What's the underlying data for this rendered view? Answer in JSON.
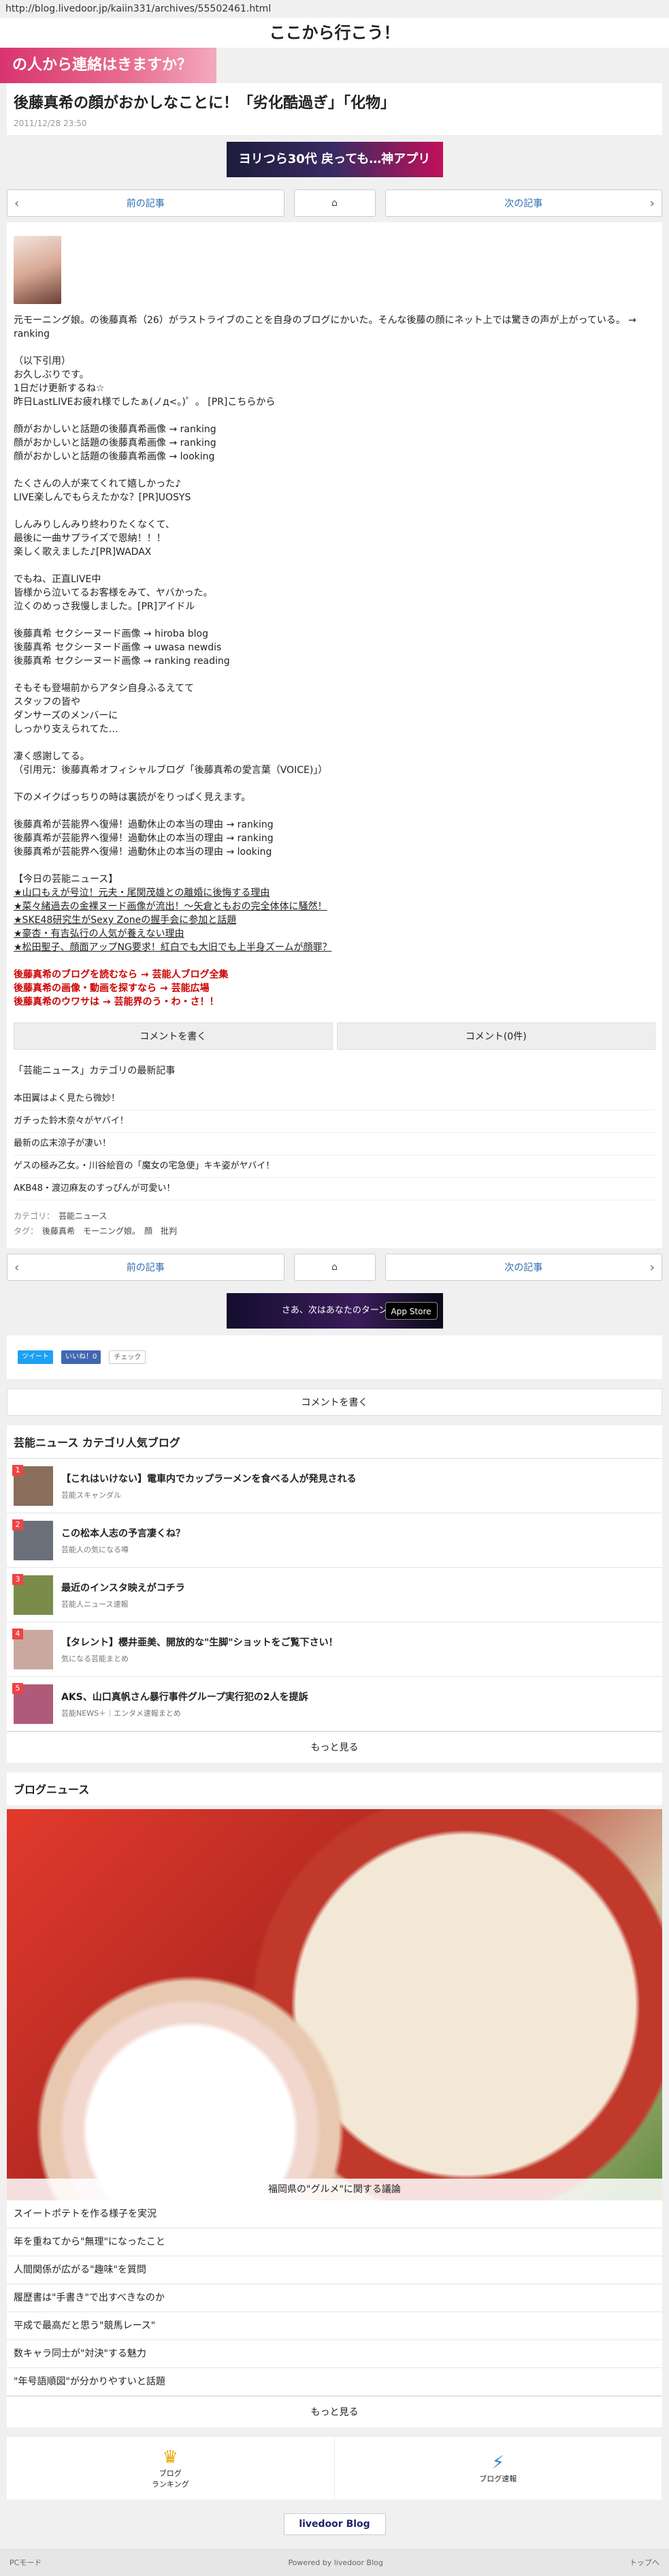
{
  "url": "http://blog.livedoor.jp/kaiin331/archives/55502461.html",
  "site_title": "ここから行こう！",
  "top_banner": "の人から連絡はきますか？",
  "article": {
    "title": "後藤真希の顔がおかしなことに！「劣化酷過ぎ」「化物」",
    "date": "2011/12/28 23:50",
    "body": [
      "元モーニング娘。の後藤真希（26）がラストライブのことを自身のブログにかいた。そんな後藤の顔にネット上では驚きの声が上がっている。 → ranking",
      "（以下引用）\nお久しぶりです。\n1日だけ更新するね☆\n昨日LastLIVEお疲れ様でしたぁ(ノд<。)゜。 [PR]こちらから",
      "顔がおかしいと話題の後藤真希画像 → ranking\n顔がおかしいと話題の後藤真希画像 → ranking\n顔がおかしいと話題の後藤真希画像 → looking",
      "たくさんの人が来てくれて嬉しかった♪\nLIVE楽しんでもらえたかな？[PR]UOSYS",
      "しんみりしんみり終わりたくなくて、\n最後に一曲サプライズで恩納！！！\n楽しく歌えました♪[PR]WADAX",
      "でもね、正直LIVE中\n皆様から泣いてるお客様をみて、ヤバかった。\n泣くのめっさ我慢しました。[PR]アイドル",
      "後藤真希 セクシーヌード画像 → hiroba blog\n後藤真希 セクシーヌード画像 → uwasa newdis\n後藤真希 セクシーヌード画像 → ranking reading",
      "そもそも登場前からアタシ自身ふるえてて\nスタッフの皆や\nダンサーズのメンバーに\nしっかり支えられてた…",
      "凄く感謝してる。\n（引用元：後藤真希オフィシャルブログ「後藤真希の愛言葉（VOICE)」）",
      "下のメイクばっちりの時は裏読がをりっぱく見えます。",
      "後藤真希が芸能界へ復帰！過動休止の本当の理由 → ranking\n後藤真希が芸能界へ復帰！過動休止の本当の理由 → ranking\n後藤真希が芸能界へ復帰！過動休止の本当の理由 → looking"
    ],
    "today_head": "【今日の芸能ニュース】",
    "today_items": [
      "★山口もえが号泣！元夫・尾関茂雄との離婚に後悔する理由",
      "★菜々緒過去の金裸ヌード画像が流出！～矢倉ともおの完全体体に騒然！",
      "★SKE48研究生がSexy Zoneの握手会に参加と話題",
      "★豪杏・有吉弘行の人気が養えない理由",
      "★松田聖子、顔面アップNG要求！紅白でも大旧でも上半身ズームが顔罪？"
    ],
    "blog_links": [
      "後藤真希のブログを読むなら → 芸能人ブログ全集",
      "後藤真希の画像・動画を探すなら → 芸能広場",
      "後藤真希のウワサは → 芸能界のう・わ・さ！！"
    ],
    "comment_write": "コメントを書く",
    "comment_count": "コメント(0件)",
    "cat_head": "「芸能ニュース」カテゴリの最新記事",
    "cat_list": [
      "本田翼はよく見たら微妙！",
      "ガチった鈴木奈々がヤバイ！",
      "最新の広末涼子が凄い！",
      "ゲスの極み乙女。・川谷絵音の「魔女の宅急便」キキ姿がヤバイ！",
      "AKB48・渡辺麻友のすっぴんが可愛い！"
    ],
    "category_label": "カテゴリ：",
    "category_value": "芸能ニュース",
    "tag_label": "タグ：",
    "tag_values": "後藤真希　モーニング娘。　顔　批判"
  },
  "nav": {
    "prev": "前の記事",
    "next": "次の記事"
  },
  "ad1": "ヨリつら30代 戻っても…神アプリ",
  "ad2": "さあ、次はあなたのターン",
  "ad2_store": "App Store",
  "social": {
    "tweet": "ツイート",
    "like": "いいね！0",
    "check": "チェック"
  },
  "comment_bar": "コメントを書く",
  "popular": {
    "head": "芸能ニュース カテゴリ人気ブログ",
    "items": [
      {
        "no": "1",
        "title": "【これはいけない】電車内でカップラーメンを食べる人が発見される",
        "sub": "芸能スキャンダル"
      },
      {
        "no": "2",
        "title": "この松本人志の予言凄くね？",
        "sub": "芸能人の気になる噂"
      },
      {
        "no": "3",
        "title": "最近のインスタ映えがコチラ",
        "sub": "芸能人ニュース速報"
      },
      {
        "no": "4",
        "title": "【タレント】櫻井亜美、開放的な\"生脚\"ショットをご覧下さい！",
        "sub": "気になる芸能まとめ"
      },
      {
        "no": "5",
        "title": "AKS、山口真帆さん暴行事件グループ実行犯の2人を提訴",
        "sub": "芸能NEWS＋｜エンタメ速報まとめ"
      }
    ],
    "more": "もっと見る"
  },
  "blog_news": {
    "head": "ブログニュース",
    "caption": "福岡県の\"グルメ\"に関する議論",
    "items": [
      "スイートポテトを作る様子を実況",
      "年を重ねてから\"無理\"になったこと",
      "人間関係が広がる\"趣味\"を質問",
      "履歴書は\"手書き\"で出すべきなのか",
      "平成で最高だと思う\"競馬レース\"",
      "数キャラ同士が\"対決\"する魅力",
      "\"年号語順図\"が分かりやすいと話題"
    ],
    "more": "もっと見る"
  },
  "footer_nav": [
    {
      "icon": "♛",
      "label": "ブログ\nランキング"
    },
    {
      "icon": "⚡",
      "label": "ブログ速報"
    }
  ],
  "logo": "livedoor Blog",
  "footer": {
    "left": "PCモード",
    "center": "Powered by livedoor Blog",
    "right": "トップへ"
  }
}
